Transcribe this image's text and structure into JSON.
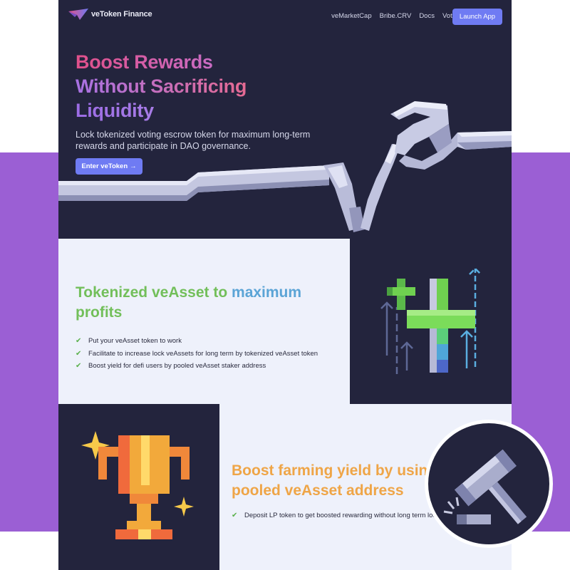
{
  "brand": {
    "name": "veToken Finance",
    "accent": "#6f7bf3",
    "page_bg": "#9b5fd4"
  },
  "nav": {
    "links": [
      "veMarketCap",
      "Bribe.CRV",
      "Docs",
      "Vote"
    ],
    "launch_label": "Launch App"
  },
  "hero": {
    "title_lines": [
      "Boost Rewards",
      "Without Sacrificing",
      "Liquidity"
    ],
    "subtitle": "Lock tokenized voting escrow token for maximum long-term rewards and participate in DAO governance.",
    "cta_label": "Enter veToken",
    "cta_icon": "arrow-right-icon"
  },
  "section2": {
    "title_green": "Tokenized veAsset to ",
    "title_blue": "maximum",
    "title_green2": "profits",
    "items": [
      "Put your veAsset token to work",
      "Facilitate to increase lock veAssets for long term by tokenized veAsset token",
      "Boost yield for defi users by pooled veAsset staker address"
    ],
    "icon": "check-icon"
  },
  "section3": {
    "title_line1": "Boost farming yield by usin",
    "title_line2": "pooled veAsset address",
    "items": [
      "Deposit LP token to get boosted rewarding without long term locking"
    ],
    "icon": "check-icon"
  },
  "icons": [
    "vetoken-logo-icon",
    "trophy-icon",
    "sparkle-icon",
    "hammer-icon",
    "plus-growth-icon",
    "arrow-up-icon"
  ]
}
